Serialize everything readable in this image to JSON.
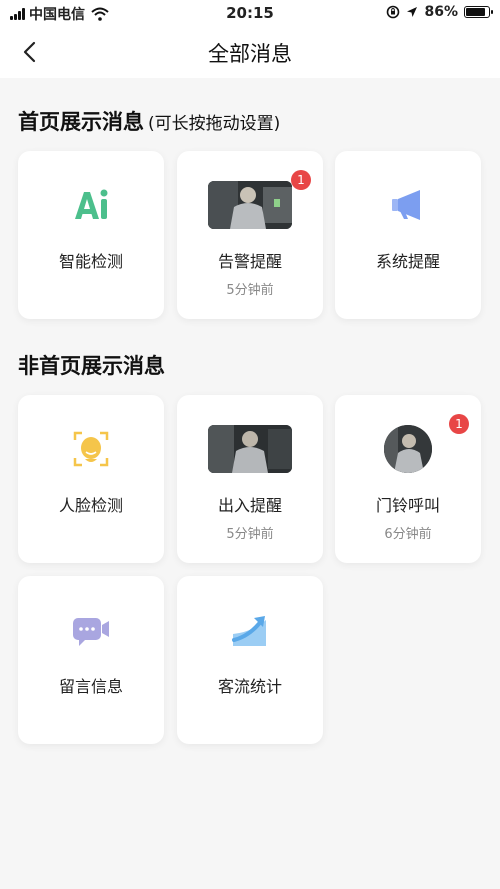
{
  "status_bar": {
    "carrier": "中国电信",
    "time": "20:15",
    "battery_percent": "86%"
  },
  "nav": {
    "title": "全部消息"
  },
  "sections": {
    "home": {
      "title": "首页展示消息",
      "hint": "(可长按拖动设置)",
      "cards": [
        {
          "label": "智能检测",
          "icon": "ai-detection-icon"
        },
        {
          "label": "告警提醒",
          "sub": "5分钟前",
          "badge": "1",
          "icon": "alarm-thumbnail"
        },
        {
          "label": "系统提醒",
          "icon": "megaphone-icon"
        }
      ]
    },
    "other": {
      "title": "非首页展示消息",
      "cards": [
        {
          "label": "人脸检测",
          "icon": "face-detection-icon"
        },
        {
          "label": "出入提醒",
          "sub": "5分钟前",
          "icon": "entry-thumbnail"
        },
        {
          "label": "门铃呼叫",
          "sub": "6分钟前",
          "badge": "1",
          "icon": "doorbell-avatar"
        },
        {
          "label": "留言信息",
          "icon": "video-message-icon"
        },
        {
          "label": "客流统计",
          "icon": "traffic-stats-icon"
        }
      ]
    }
  },
  "colors": {
    "ai_green": "#4cbf8c",
    "megaphone_blue": "#7c9ef0",
    "face_yellow": "#f5c54a",
    "message_purple": "#a9a6e0",
    "stats_blue": "#5aa8e8",
    "badge_red": "#e84646"
  }
}
